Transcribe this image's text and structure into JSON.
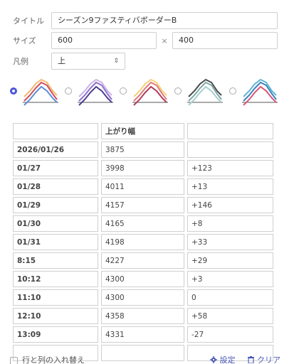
{
  "form": {
    "title_label": "タイトル",
    "title_value": "シーズン9ファスティバボーダーB",
    "size_label": "サイズ",
    "width": "600",
    "times": "×",
    "height": "400",
    "legend_label": "凡例",
    "legend_value": "上",
    "legend_arrow": "⇕"
  },
  "chart_styles": [
    {
      "name": "style-1",
      "selected": true
    },
    {
      "name": "style-2",
      "selected": false
    },
    {
      "name": "style-3",
      "selected": false
    },
    {
      "name": "style-4",
      "selected": false
    },
    {
      "name": "style-5",
      "selected": false
    }
  ],
  "table": {
    "header": [
      "",
      "上がり幅",
      ""
    ],
    "rows": [
      [
        "2026/01/26",
        "3875",
        ""
      ],
      [
        "01/27",
        "3998",
        "+123"
      ],
      [
        "01/28",
        "4011",
        "+13"
      ],
      [
        "01/29",
        "4157",
        "+146"
      ],
      [
        "01/30",
        "4165",
        "+8"
      ],
      [
        "01/31",
        "4198",
        "+33"
      ],
      [
        " 8:15",
        "4227",
        "+29"
      ],
      [
        "10:12",
        "4300",
        "+3"
      ],
      [
        "11:10",
        "4300",
        "0"
      ],
      [
        "12:10",
        "4358",
        "+58"
      ],
      [
        "13:09",
        "4331",
        "-27"
      ],
      [
        "",
        "",
        ""
      ]
    ]
  },
  "footer": {
    "transpose_label": "行と列の入れ替え",
    "settings_label": "設定",
    "clear_label": "クリア"
  }
}
